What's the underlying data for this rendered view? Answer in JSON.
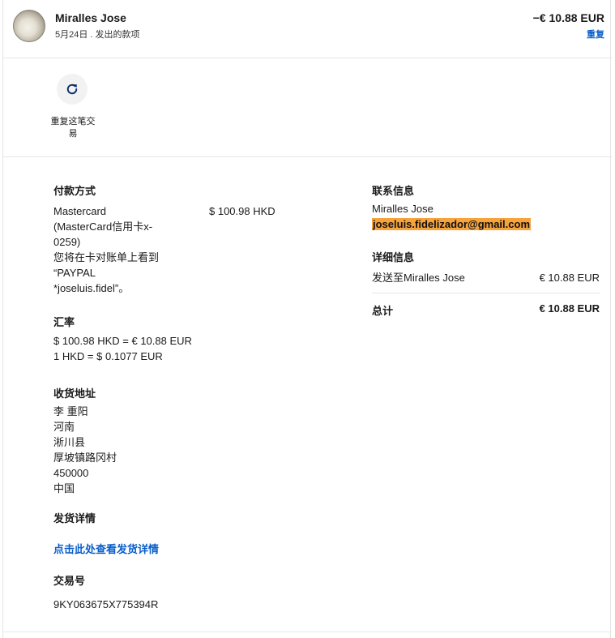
{
  "header": {
    "name": "Miralles Jose",
    "subtitle": "5月24日 . 发出的款项",
    "amount": "−€ 10.88 EUR",
    "repeat_link": "重复"
  },
  "actions": {
    "repeat_label": "重复这笔交易",
    "repeat_icon": "refresh-icon"
  },
  "payment": {
    "title": "付款方式",
    "method_lines": [
      "Mastercard",
      "(MasterCard信用卡x-",
      "0259)",
      "您将在卡对账单上看到",
      "“PAYPAL",
      "*joseluis.fidel”。"
    ],
    "amount": "$ 100.98 HKD"
  },
  "exchange": {
    "title": "汇率",
    "line1": "$ 100.98 HKD = € 10.88 EUR",
    "line2": "1 HKD = $ 0.1077 EUR"
  },
  "shipping_address": {
    "title": "收货地址",
    "lines": [
      "李 重阳",
      "河南",
      "淅川县",
      "厚坡镇路冈村",
      "450000",
      "中国"
    ]
  },
  "shipping_details": {
    "title": "发货详情",
    "link": "点击此处查看发货详情"
  },
  "transaction": {
    "title": "交易号",
    "id": "9KY063675X775394R"
  },
  "contact": {
    "title": "联系信息",
    "name": "Miralles Jose",
    "email": "joseluis.fidelizador@gmail.com",
    "highlight_color": "#f7a33c"
  },
  "details": {
    "title": "详细信息",
    "sent_to_label": "发送至Miralles Jose",
    "sent_to_amount": "€ 10.88 EUR",
    "total_label": "总计",
    "total_amount": "€ 10.88 EUR"
  },
  "colors": {
    "link": "#0a5ec9",
    "text": "#1a1a1a"
  }
}
